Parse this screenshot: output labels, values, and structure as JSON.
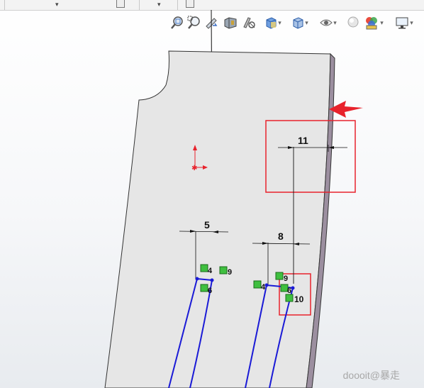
{
  "heads_up_toolbar": {
    "items": [
      {
        "name": "zoom-to-fit-icon"
      },
      {
        "name": "zoom-to-area-icon"
      },
      {
        "name": "previous-view-icon"
      },
      {
        "name": "section-view-icon"
      },
      {
        "name": "dynamic-annotation-icon"
      },
      {
        "name": "view-orientation-icon",
        "has_dropdown": true
      },
      {
        "name": "display-style-icon",
        "has_dropdown": true
      },
      {
        "name": "hide-show-items-icon",
        "has_dropdown": true
      },
      {
        "name": "edit-appearance-icon",
        "has_dropdown": false
      },
      {
        "name": "apply-scene-icon",
        "has_dropdown": true
      },
      {
        "name": "view-settings-icon",
        "has_dropdown": true
      }
    ]
  },
  "sketch": {
    "dimensions": [
      {
        "id": "dim-5",
        "value": "5"
      },
      {
        "id": "dim-8",
        "value": "8"
      },
      {
        "id": "dim-11",
        "value": "11"
      }
    ],
    "relations": [
      {
        "id": "rel-a",
        "label": "4"
      },
      {
        "id": "rel-b",
        "label": "9"
      },
      {
        "id": "rel-c",
        "label": "6"
      },
      {
        "id": "rel-d",
        "label": "4"
      },
      {
        "id": "rel-e",
        "label": "9"
      },
      {
        "id": "rel-f",
        "label": "6"
      },
      {
        "id": "rel-g",
        "label": "10"
      }
    ]
  },
  "colors": {
    "annotation_red": "#e8222c",
    "sketch_blue": "#1a1ad6",
    "relation_green": "#3fbf3f",
    "part_face": "#e6e6e6",
    "part_edge": "#9c8fa0"
  },
  "watermark": "doooit@暴走"
}
